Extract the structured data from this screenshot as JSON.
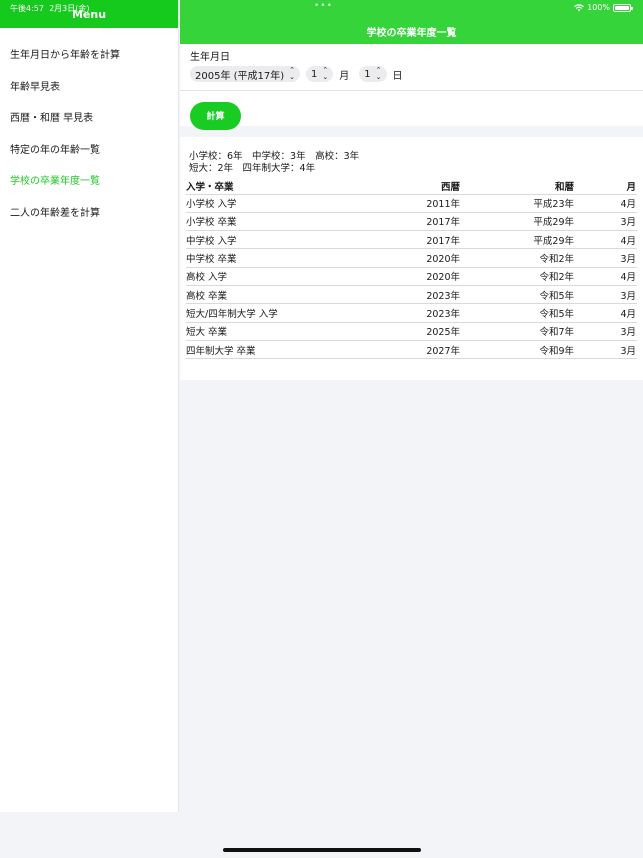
{
  "status": {
    "time": "午後4:57",
    "date": "2月3日(金)",
    "battery": "100%"
  },
  "sidebar": {
    "title": "Menu",
    "items": [
      {
        "label": "生年月日から年齢を計算"
      },
      {
        "label": "年齢早見表"
      },
      {
        "label": "西暦・和暦 早見表"
      },
      {
        "label": "特定の年の年齢一覧"
      },
      {
        "label": "学校の卒業年度一覧",
        "active": true
      },
      {
        "label": "二人の年齢差を計算"
      }
    ]
  },
  "nav": {
    "title": "学校の卒業年度一覧"
  },
  "form": {
    "label": "生年月日",
    "year": "2005年 (平成17年)",
    "month": "1",
    "month_unit": "月",
    "day": "1",
    "day_unit": "日",
    "calc_label": "計算"
  },
  "result": {
    "summary1": "小学校：6年　中学校：3年　高校：3年",
    "summary2": "短大：2年　四年制大学：4年",
    "headers": [
      "入学・卒業",
      "西暦",
      "和暦",
      "月"
    ],
    "rows": [
      [
        "小学校 入学",
        "2011年",
        "平成23年",
        "4月"
      ],
      [
        "小学校 卒業",
        "2017年",
        "平成29年",
        "3月"
      ],
      [
        "中学校 入学",
        "2017年",
        "平成29年",
        "4月"
      ],
      [
        "中学校 卒業",
        "2020年",
        "令和2年",
        "3月"
      ],
      [
        "高校 入学",
        "2020年",
        "令和2年",
        "4月"
      ],
      [
        "高校 卒業",
        "2023年",
        "令和5年",
        "3月"
      ],
      [
        "短大/四年制大学 入学",
        "2023年",
        "令和5年",
        "4月"
      ],
      [
        "短大 卒業",
        "2025年",
        "令和7年",
        "3月"
      ],
      [
        "四年制大学 卒業",
        "2027年",
        "令和9年",
        "3月"
      ]
    ]
  }
}
